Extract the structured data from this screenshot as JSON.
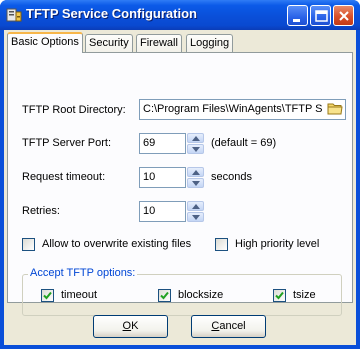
{
  "window": {
    "title": "TFTP Service Configuration"
  },
  "tabs": [
    {
      "label": "Basic Options",
      "active": true
    },
    {
      "label": "Security",
      "active": false
    },
    {
      "label": "Firewall",
      "active": false
    },
    {
      "label": "Logging",
      "active": false
    }
  ],
  "form": {
    "root_dir": {
      "label": "TFTP Root Directory:",
      "value": "C:\\Program Files\\WinAgents\\TFTP S"
    },
    "port": {
      "label": "TFTP Server Port:",
      "value": "69",
      "hint": "(default = 69)"
    },
    "timeout": {
      "label": "Request timeout:",
      "value": "10",
      "unit": "seconds"
    },
    "retries": {
      "label": "Retries:",
      "value": "10"
    },
    "overwrite": {
      "label": "Allow to overwrite existing files",
      "checked": false
    },
    "high_priority": {
      "label": "High priority level",
      "checked": false
    }
  },
  "accept_options": {
    "title": "Accept TFTP options:",
    "timeout": {
      "label": "timeout",
      "checked": true
    },
    "blocksize": {
      "label": "blocksize",
      "checked": true
    },
    "tsize": {
      "label": "tsize",
      "checked": true
    }
  },
  "buttons": {
    "ok_mnemonic": "O",
    "ok_rest": "K",
    "cancel_mnemonic": "C",
    "cancel_rest": "ancel"
  },
  "colors": {
    "titlebar": "#0a4fd9",
    "dialog_face": "#ece9d8",
    "group_title": "#0046d5",
    "check_mark": "#21a121",
    "active_tab_accent": "#f7b64a"
  }
}
